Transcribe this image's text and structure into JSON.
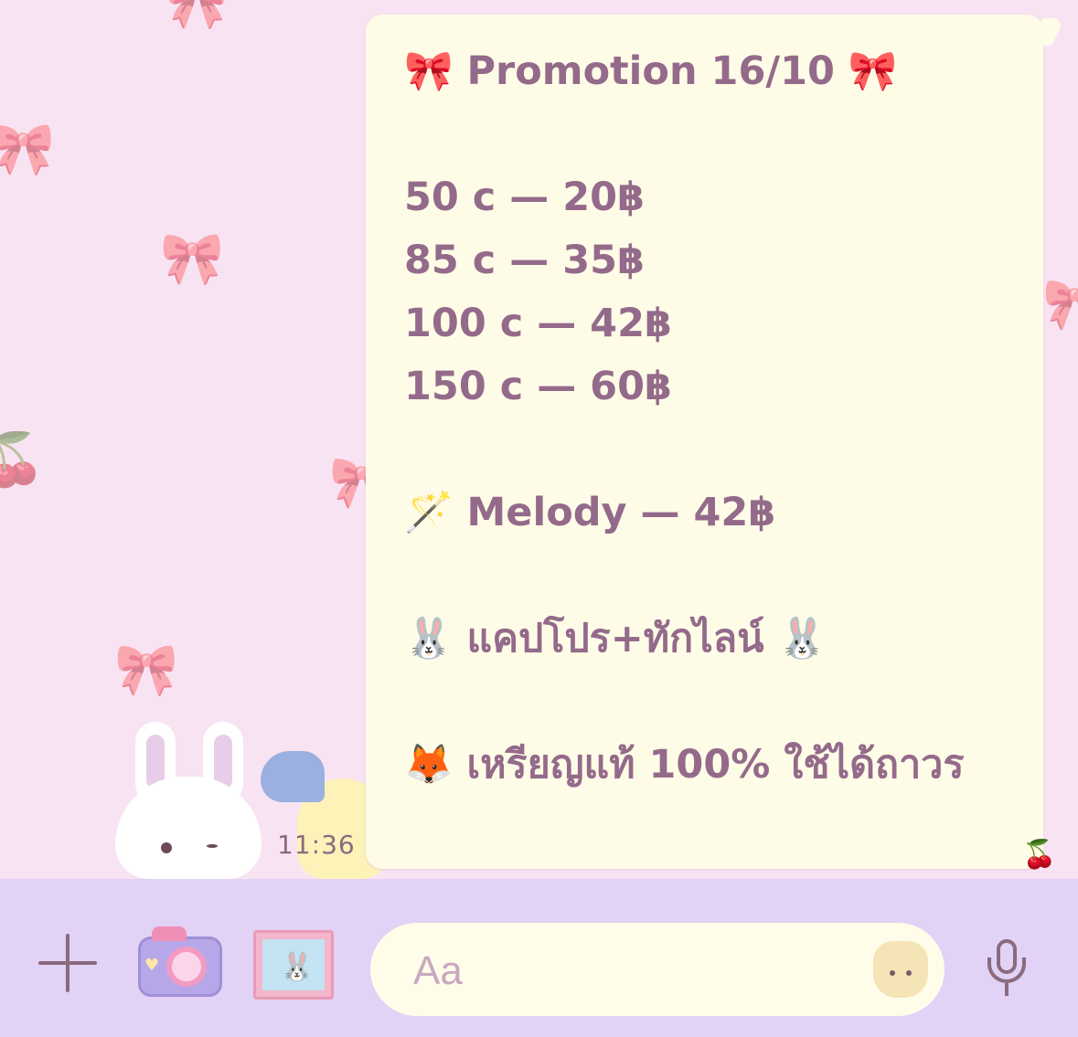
{
  "message": {
    "time": "11:36",
    "lines": [
      "🎀 Promotion 16/10 🎀",
      "",
      "50 c — 20฿",
      "85 c — 35฿",
      "100 c — 42฿",
      "150 c — 60฿",
      "",
      "🪄 Melody — 42฿",
      "",
      "🐰 แคปโปร+ทักไลน์ 🐰",
      "",
      "🦊 เหรียญแท้ 100% ใช้ได้ถาวร"
    ]
  },
  "composer": {
    "placeholder": "Aa"
  },
  "icons": {
    "plus": "plus-icon",
    "camera": "camera-icon",
    "gallery": "gallery-icon",
    "sticker": "sticker-icon",
    "mic": "microphone-icon"
  },
  "colors": {
    "bubble": "#fefce7",
    "text": "#946a8a",
    "background": "#f8e3f3",
    "toolbar": "#e2d2f5"
  }
}
